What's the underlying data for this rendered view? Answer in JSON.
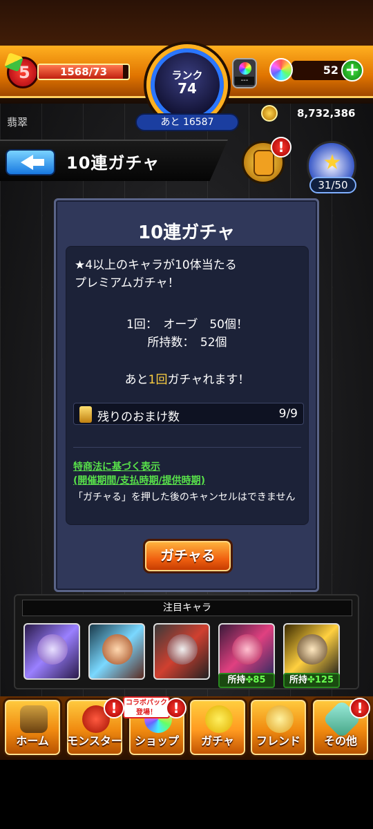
{
  "header": {
    "level_num": "5",
    "exp_text": "1568/73",
    "exp_fill_fraction": 0.94,
    "rank_label": "ランク",
    "rank_value": "74",
    "rank_remaining": "あと 16587",
    "orb_box_text": "---",
    "orb_count": "52",
    "plus_label": "+",
    "username": "翡翠",
    "coins": "8,732,386"
  },
  "titlebar": {
    "title": "10連ガチャ",
    "gift_badge": "!",
    "clover_count": "31/50"
  },
  "panel": {
    "title": "10連ガチャ",
    "description_line1": "★4以上のキャラが10体当たる",
    "description_line2": "プレミアムガチャ！",
    "cost_line": "1回：　オーブ　50個！",
    "owned_line": "所持数：　52個",
    "remaining_prefix": "あと",
    "remaining_count": "1回",
    "remaining_suffix": "ガチャれます！",
    "omake_label": "残りのおまけ数",
    "omake_value": "9/9",
    "law_link": "特商法に基づく表示",
    "law_link2": "(開催期間/支払時期/提供時期)",
    "cancel_note": "「ガチャる」を押した後のキャンセルはできません",
    "gacha_button": "ガチャる"
  },
  "featured": {
    "heading": "注目キャラ",
    "characters": [
      {
        "owned": ""
      },
      {
        "owned": ""
      },
      {
        "owned": ""
      },
      {
        "owned_prefix": "所持",
        "owned_count": "✤85"
      },
      {
        "owned_prefix": "所持",
        "owned_count": "✤125"
      }
    ]
  },
  "nav": {
    "tabs": [
      {
        "label": "ホーム"
      },
      {
        "label": "モンスター"
      },
      {
        "label": "ショップ"
      },
      {
        "label": "ガチャ"
      },
      {
        "label": "フレンド"
      },
      {
        "label": "その他"
      }
    ],
    "collab_badge_line1": "コラボパック",
    "collab_badge_line2": "登場！",
    "badge": "!"
  },
  "colors": {
    "accent_orange": "#f08a10",
    "panel_bg": "#30385a",
    "link_green": "#58e04a",
    "highlight_yellow": "#ffd040"
  }
}
